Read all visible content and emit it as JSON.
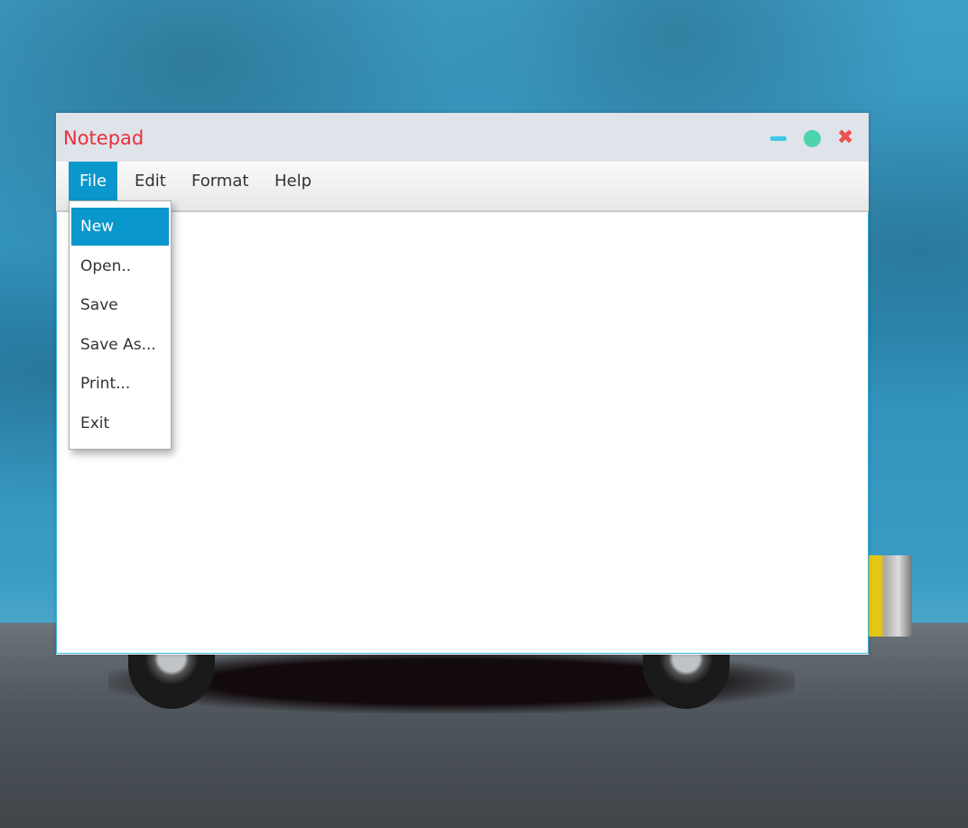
{
  "window": {
    "title": "Notepad",
    "close_glyph": "✖"
  },
  "menubar": {
    "items": [
      {
        "label": "File"
      },
      {
        "label": "Edit"
      },
      {
        "label": "Format"
      },
      {
        "label": "Help"
      }
    ],
    "active": "File"
  },
  "file_menu": {
    "items": [
      {
        "label": "New"
      },
      {
        "label": "Open.."
      },
      {
        "label": "Save"
      },
      {
        "label": "Save As..."
      },
      {
        "label": "Print..."
      },
      {
        "label": "Exit"
      }
    ],
    "highlighted": "New"
  },
  "editor": {
    "value": ""
  },
  "colors": {
    "accent": "#0a97cb",
    "title": "#e8303a",
    "minimize": "#3dc8ea",
    "maximize": "#4dd4ac",
    "close": "#f0504f"
  }
}
